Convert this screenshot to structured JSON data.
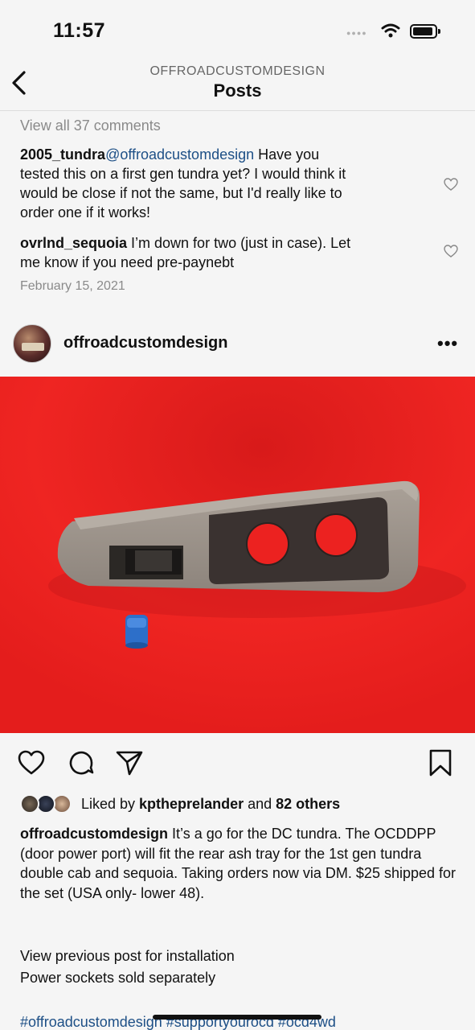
{
  "status": {
    "time": "11:57"
  },
  "nav": {
    "account": "OFFROADCUSTOMDESIGN",
    "title": "Posts"
  },
  "comments": {
    "view_all": "View all 37 comments",
    "items": [
      {
        "user": "2005_tundra",
        "mention": "@offroadcustomdesign",
        "text_line1": " Have you",
        "text_rest_lines": [
          "tested this on a first gen tundra yet? I would think it",
          "would be close if not the same, but I'd really like to",
          "order one if it works!"
        ]
      },
      {
        "user": "ovrlnd_sequoia",
        "text_line1": " I’m down for two (just in case). Let",
        "text_rest_lines": [
          "me know if you need pre-paynebt"
        ]
      }
    ],
    "date": "February 15, 2021"
  },
  "post": {
    "username": "offroadcustomdesign",
    "more": "•••",
    "image_icon": "power-port-tray-photo",
    "likes": {
      "prefix": "Liked by ",
      "user": "kptheprelander",
      "middle": " and ",
      "others": "82 others"
    },
    "caption": {
      "user": "offroadcustomdesign",
      "text": " It’s a go for the DC tundra. The OCDDPP (door power port) will fit the rear ash tray for the 1st gen tundra double cab and sequoia. Taking orders now via DM. $25 shipped for the set (USA only- lower 48).",
      "line2": "View previous post for installation",
      "line3": "Power sockets sold separately",
      "hashtags": "#offroadcustomdesign #supportyourocd #ocd4wd"
    }
  },
  "colors": {
    "link": "#1d4f86",
    "image_bg": "#e81f1d",
    "panel": "#9a9188"
  }
}
